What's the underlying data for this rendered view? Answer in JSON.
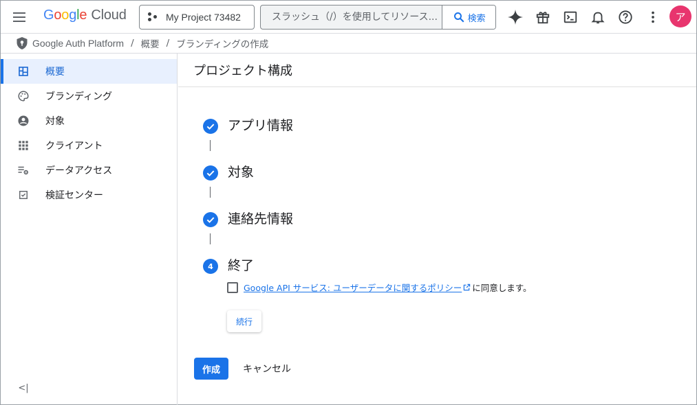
{
  "header": {
    "logo_parts": [
      "G",
      "o",
      "o",
      "g",
      "l",
      "e"
    ],
    "logo_product": "Cloud",
    "project": "My Project 73482",
    "search_placeholder": "スラッシュ（/）を使用してリソース...",
    "search_button": "検索",
    "avatar_letter": "ア",
    "avatar_color": "#e8356e"
  },
  "breadcrumb": {
    "items": [
      "Google Auth Platform",
      "概要",
      "ブランディングの作成"
    ],
    "separator": "/"
  },
  "sidebar": {
    "items": [
      {
        "label": "概要",
        "icon": "dashboard-icon",
        "active": true
      },
      {
        "label": "ブランディング",
        "icon": "palette-icon",
        "active": false
      },
      {
        "label": "対象",
        "icon": "person-circle-icon",
        "active": false
      },
      {
        "label": "クライアント",
        "icon": "grid-apps-icon",
        "active": false
      },
      {
        "label": "データアクセス",
        "icon": "data-settings-icon",
        "active": false
      },
      {
        "label": "検証センター",
        "icon": "checkbox-icon",
        "active": false
      }
    ],
    "collapse_label": "<|"
  },
  "main": {
    "title": "プロジェクト構成",
    "steps": [
      {
        "marker": "✓",
        "title": "アプリ情報",
        "status": "done"
      },
      {
        "marker": "✓",
        "title": "対象",
        "status": "done"
      },
      {
        "marker": "✓",
        "title": "連絡先情報",
        "status": "done"
      },
      {
        "marker": "4",
        "title": "終了",
        "status": "current"
      }
    ],
    "agree_link": "Google API サービス: ユーザーデータに関するポリシー",
    "agree_suffix": "に同意します。",
    "continue_button": "続行",
    "create_button": "作成",
    "cancel_button": "キャンセル"
  },
  "colors": {
    "accent": "#1a73e8",
    "active_nav_bg": "#e8f0fe"
  }
}
